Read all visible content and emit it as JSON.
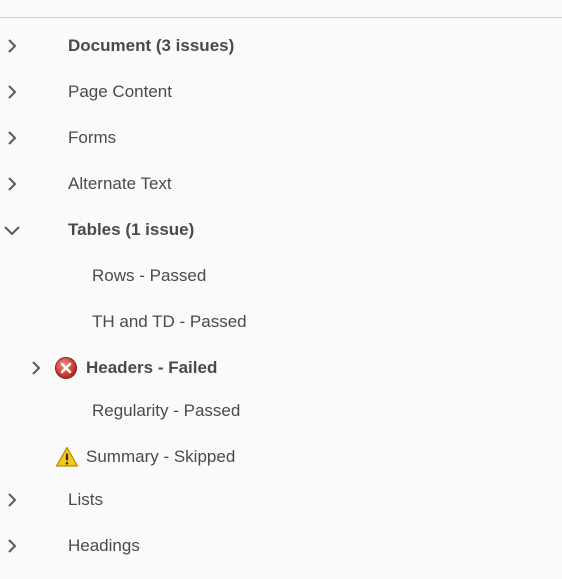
{
  "tree": {
    "document": {
      "label": "Document (3 issues)",
      "expanded": false
    },
    "page_content": {
      "label": "Page Content",
      "expanded": false
    },
    "forms": {
      "label": "Forms",
      "expanded": false
    },
    "alternate_text": {
      "label": "Alternate Text",
      "expanded": false
    },
    "tables": {
      "label": "Tables (1 issue)",
      "expanded": true,
      "children": {
        "rows": {
          "label": "Rows - Passed",
          "status": "passed"
        },
        "th_and_td": {
          "label": "TH and TD - Passed",
          "status": "passed"
        },
        "headers": {
          "label": "Headers - Failed",
          "status": "failed",
          "expanded": false,
          "icon": "failed-icon"
        },
        "regularity": {
          "label": "Regularity - Passed",
          "status": "passed"
        },
        "summary": {
          "label": "Summary - Skipped",
          "status": "skipped",
          "icon": "warning-icon"
        }
      }
    },
    "lists": {
      "label": "Lists",
      "expanded": false
    },
    "headings": {
      "label": "Headings",
      "expanded": false
    }
  },
  "colors": {
    "text": "#4a4a4a",
    "chevron": "#5a5a5a",
    "failed_red": "#c9352c",
    "warning_yellow": "#f5c518",
    "background": "#fafafa"
  }
}
